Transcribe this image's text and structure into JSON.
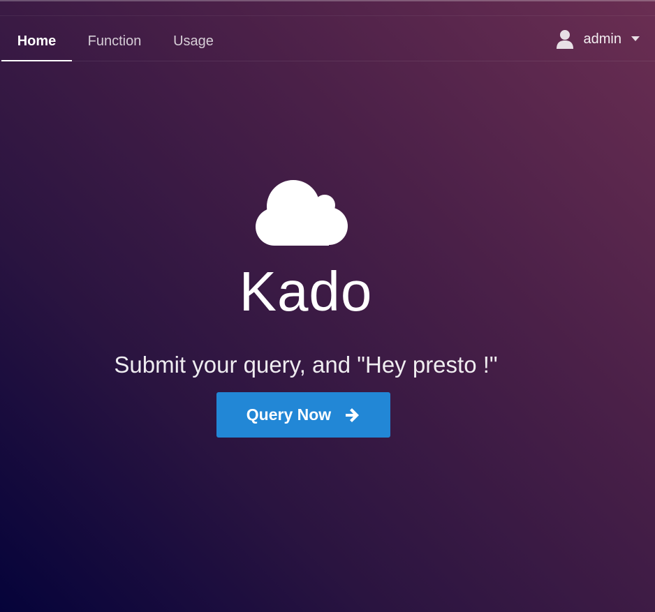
{
  "nav": {
    "tabs": [
      {
        "label": "Home",
        "active": true
      },
      {
        "label": "Function",
        "active": false
      },
      {
        "label": "Usage",
        "active": false
      }
    ],
    "user": {
      "name": "admin",
      "icon": "user-icon",
      "dropdown_icon": "caret-down-icon"
    }
  },
  "hero": {
    "logo_icon": "cloud-icon",
    "brand": "Kado",
    "tagline": "Submit your query, and \"Hey presto !\"",
    "cta_label": "Query Now",
    "cta_icon": "arrow-right-icon"
  },
  "colors": {
    "background_top_right": "#6a2e52",
    "background_bottom_left": "#05033a",
    "cta": "#2287d6",
    "text": "#ffffff"
  }
}
